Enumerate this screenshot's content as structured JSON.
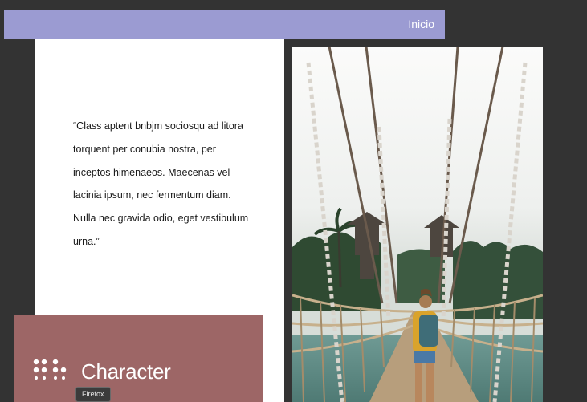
{
  "header": {
    "nav_link": "Inicio"
  },
  "content": {
    "quote": "“Class aptent bnbjm sociosqu ad litora torquent per conubia nostra, per inceptos himenaeos. Maecenas vel lacinia ipsum, nec fermentum diam. Nulla nec gravida odio, eget vestibulum urna.”"
  },
  "brand": {
    "name": "Character",
    "logo_icon": "dot-grid-logo-icon"
  },
  "tooltip": {
    "text": "Firefox"
  },
  "colors": {
    "header_bg": "#9b9bd2",
    "page_bg": "#333333",
    "brand_card_bg": "#9d6666",
    "panel_bg": "#ffffff"
  }
}
